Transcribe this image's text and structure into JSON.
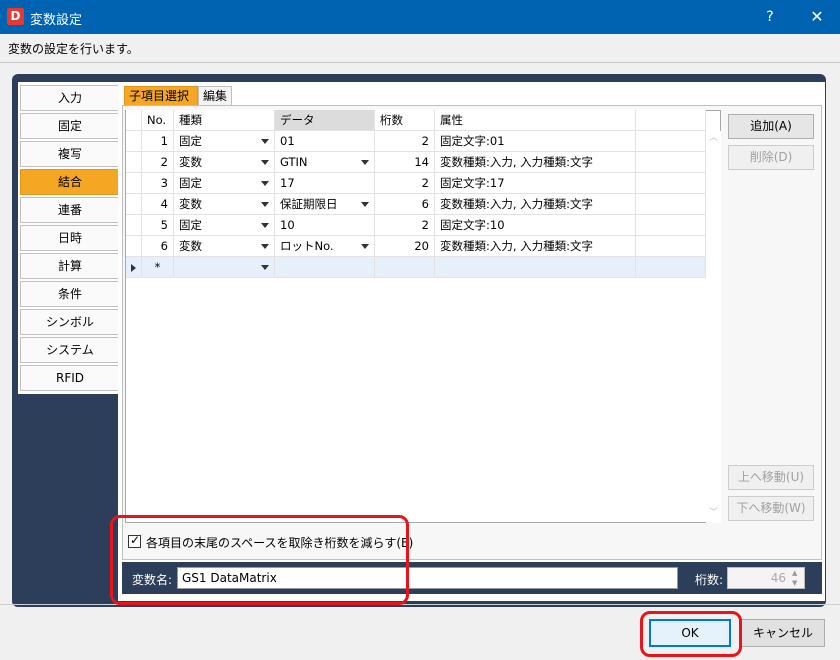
{
  "window": {
    "app_icon": "D",
    "title": "変数設定",
    "help_glyph": "?",
    "close_glyph": "✕"
  },
  "subtitle": "変数の設定を行います。",
  "nav": {
    "items": [
      "入力",
      "固定",
      "複写",
      "結合",
      "連番",
      "日時",
      "計算",
      "条件",
      "シンボル",
      "システム",
      "RFID"
    ],
    "active": "結合"
  },
  "tabs": [
    "子項目選択",
    "編集"
  ],
  "grid": {
    "headers": [
      "No.",
      "種類",
      "データ",
      "桁数",
      "属性"
    ],
    "rows": [
      {
        "no": "1",
        "kind": "固定",
        "data": "01",
        "digits": "2",
        "attr": "固定文字:01",
        "data_dd": false
      },
      {
        "no": "2",
        "kind": "変数",
        "data": "GTIN",
        "digits": "14",
        "attr": "変数種類:入力, 入力種類:文字",
        "data_dd": true
      },
      {
        "no": "3",
        "kind": "固定",
        "data": "17",
        "digits": "2",
        "attr": "固定文字:17",
        "data_dd": false
      },
      {
        "no": "4",
        "kind": "変数",
        "data": "保証期限日",
        "digits": "6",
        "attr": "変数種類:入力, 入力種類:文字",
        "data_dd": true
      },
      {
        "no": "5",
        "kind": "固定",
        "data": "10",
        "digits": "2",
        "attr": "固定文字:10",
        "data_dd": false
      },
      {
        "no": "6",
        "kind": "変数",
        "data": "ロットNo.",
        "digits": "20",
        "attr": "変数種類:入力, 入力種類:文字",
        "data_dd": true
      }
    ],
    "new_row_marker": "*"
  },
  "side_buttons": {
    "add": "追加(A)",
    "delete": "削除(D)",
    "move_up": "上へ移動(U)",
    "move_down": "下へ移動(W)"
  },
  "trim_checkbox": {
    "label": "各項目の末尾のスペースを取除き桁数を減らす(E)",
    "checked": true
  },
  "variable_name": {
    "label": "変数名:",
    "value": "GS1 DataMatrix"
  },
  "digit_count": {
    "label": "桁数:",
    "value": "46"
  },
  "buttons": {
    "ok": "OK",
    "cancel": "キャンセル"
  }
}
